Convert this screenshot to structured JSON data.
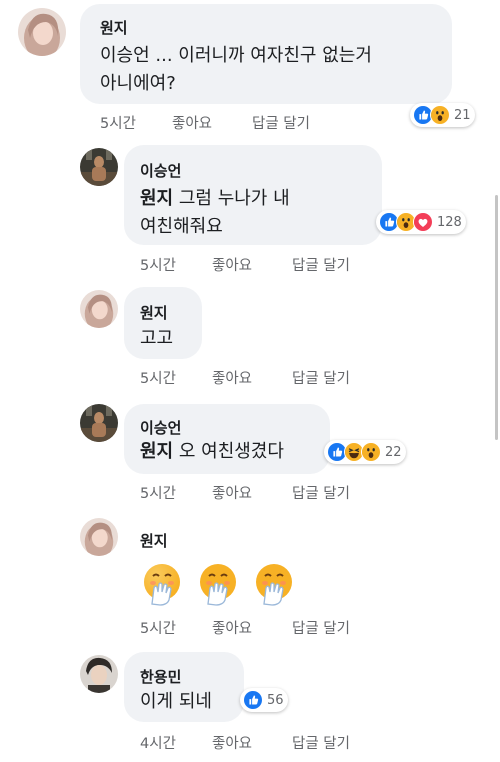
{
  "comments": [
    {
      "author": "원지",
      "text_line1": "이승언 ... 이러니까 여자친구 없는거",
      "text_line2": "아니에여?",
      "time": "5시간",
      "like": "좋아요",
      "reply": "답글 달기",
      "reactions": [
        "like-icon",
        "wow-icon"
      ],
      "reaction_count": "21"
    },
    {
      "author": "이승언",
      "tag": "원지",
      "text_line1_rest": " 그럼 누나가 내",
      "text_line2": "여친해줘요",
      "time": "5시간",
      "like": "좋아요",
      "reply": "답글 달기",
      "reactions": [
        "like-icon",
        "wow-icon",
        "love-icon"
      ],
      "reaction_count": "128"
    },
    {
      "author": "원지",
      "text_line1": "고고",
      "time": "5시간",
      "like": "좋아요",
      "reply": "답글 달기"
    },
    {
      "author": "이승언",
      "tag": "원지",
      "text_line1_rest": " 오 여친생겼다",
      "time": "5시간",
      "like": "좋아요",
      "reply": "답글 달기",
      "reactions": [
        "like-icon",
        "haha-icon",
        "wow-icon"
      ],
      "reaction_count": "22"
    },
    {
      "author": "원지",
      "emojis": [
        "hand-over-mouth-emoji",
        "hand-over-mouth-emoji",
        "hand-over-mouth-emoji"
      ],
      "time": "5시간",
      "like": "좋아요",
      "reply": "답글 달기"
    },
    {
      "author": "한용민",
      "text_line1": "이게 되네",
      "time": "4시간",
      "like": "좋아요",
      "reply": "답글 달기",
      "reactions": [
        "like-icon"
      ],
      "reaction_count": "56"
    }
  ],
  "colors": {
    "bubble": "#f0f2f5",
    "meta_text": "#65676b",
    "like_blue": "#1877f2",
    "love_red": "#f33e58",
    "emoji_yellow": "#f7b125"
  }
}
